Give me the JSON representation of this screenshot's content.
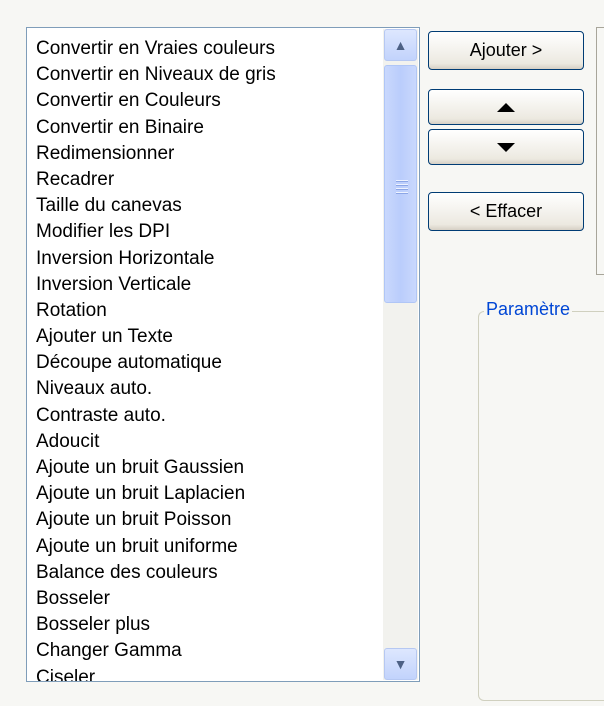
{
  "filter_list": {
    "items": [
      "Convertir en Vraies couleurs",
      "Convertir en Niveaux de gris",
      "Convertir en Couleurs",
      "Convertir en Binaire",
      "Redimensionner",
      "Recadrer",
      "Taille du canevas",
      "Modifier les DPI",
      "Inversion Horizontale",
      "Inversion Verticale",
      "Rotation",
      "Ajouter un Texte",
      "Découpe automatique",
      "Niveaux auto.",
      "Contraste auto.",
      "Adoucit",
      "Ajoute un bruit Gaussien",
      "Ajoute un bruit Laplacien",
      "Ajoute un bruit Poisson",
      "Ajoute un bruit uniforme",
      "Balance des couleurs",
      "Bosseler",
      "Bosseler plus",
      "Changer Gamma",
      "Ciseler"
    ]
  },
  "buttons": {
    "add_label": "Ajouter >",
    "clear_label": "< Effacer",
    "move_up_icon": "triangle-up-icon",
    "move_down_icon": "triangle-down-icon"
  },
  "params": {
    "legend": "Paramètre"
  },
  "colors": {
    "legend_text": "#0046d5",
    "button_border": "#003c74",
    "list_border": "#7f9db9"
  }
}
